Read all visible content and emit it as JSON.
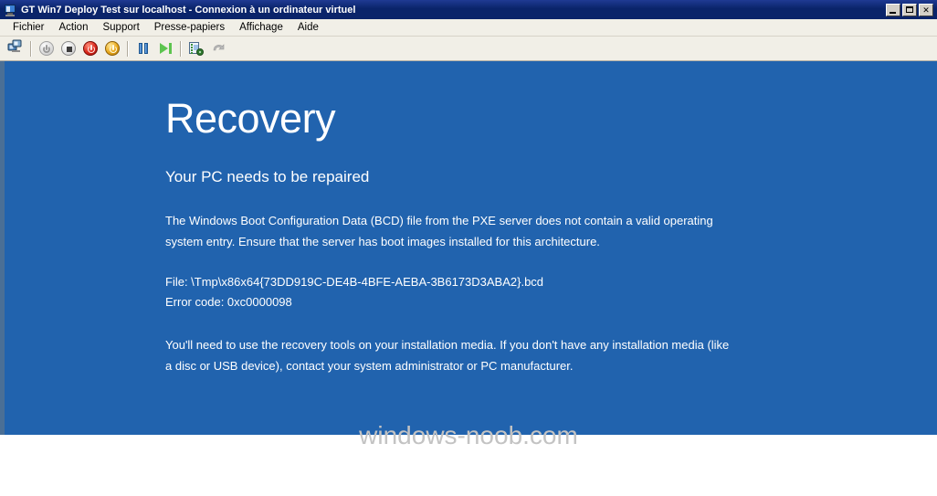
{
  "window": {
    "title": "GT Win7 Deploy Test sur localhost - Connexion à un ordinateur virtuel",
    "icon": "virtual-machine-icon",
    "controls": {
      "minimize": "_",
      "maximize": "□",
      "close": "✕"
    }
  },
  "menubar": {
    "items": [
      {
        "label": "Fichier"
      },
      {
        "label": "Action"
      },
      {
        "label": "Support"
      },
      {
        "label": "Presse-papiers"
      },
      {
        "label": "Affichage"
      },
      {
        "label": "Aide"
      }
    ]
  },
  "toolbar": {
    "items": [
      {
        "name": "ctrl-alt-del-icon",
        "enabled": true
      },
      {
        "name": "power-on-icon",
        "enabled": false
      },
      {
        "name": "shut-down-icon",
        "enabled": true
      },
      {
        "name": "turn-off-icon",
        "enabled": true
      },
      {
        "name": "reset-icon",
        "enabled": true
      },
      {
        "name": "pause-icon",
        "enabled": true
      },
      {
        "name": "resume-icon",
        "enabled": true
      },
      {
        "name": "snapshot-icon",
        "enabled": true
      },
      {
        "name": "revert-icon",
        "enabled": true
      }
    ]
  },
  "recovery": {
    "title": "Recovery",
    "subtitle": "Your PC needs to be repaired",
    "body": "The Windows Boot Configuration Data (BCD) file from the PXE server does not contain a valid operating system entry. Ensure that the server has boot images installed for this architecture.",
    "file_line": "File: \\Tmp\\x86x64{73DD919C-DE4B-4BFE-AEBA-3B6173D3ABA2}.bcd",
    "error_line": "Error code: 0xc0000098",
    "footer": "You'll need to use the recovery tools on your installation media. If you don't have any installation media (like a disc or USB device), contact your system administrator or PC manufacturer.",
    "background_color": "#2163ae",
    "text_color": "#ffffff"
  },
  "watermark": {
    "text": "windows-noob.com",
    "color": "#c3c3c3"
  }
}
